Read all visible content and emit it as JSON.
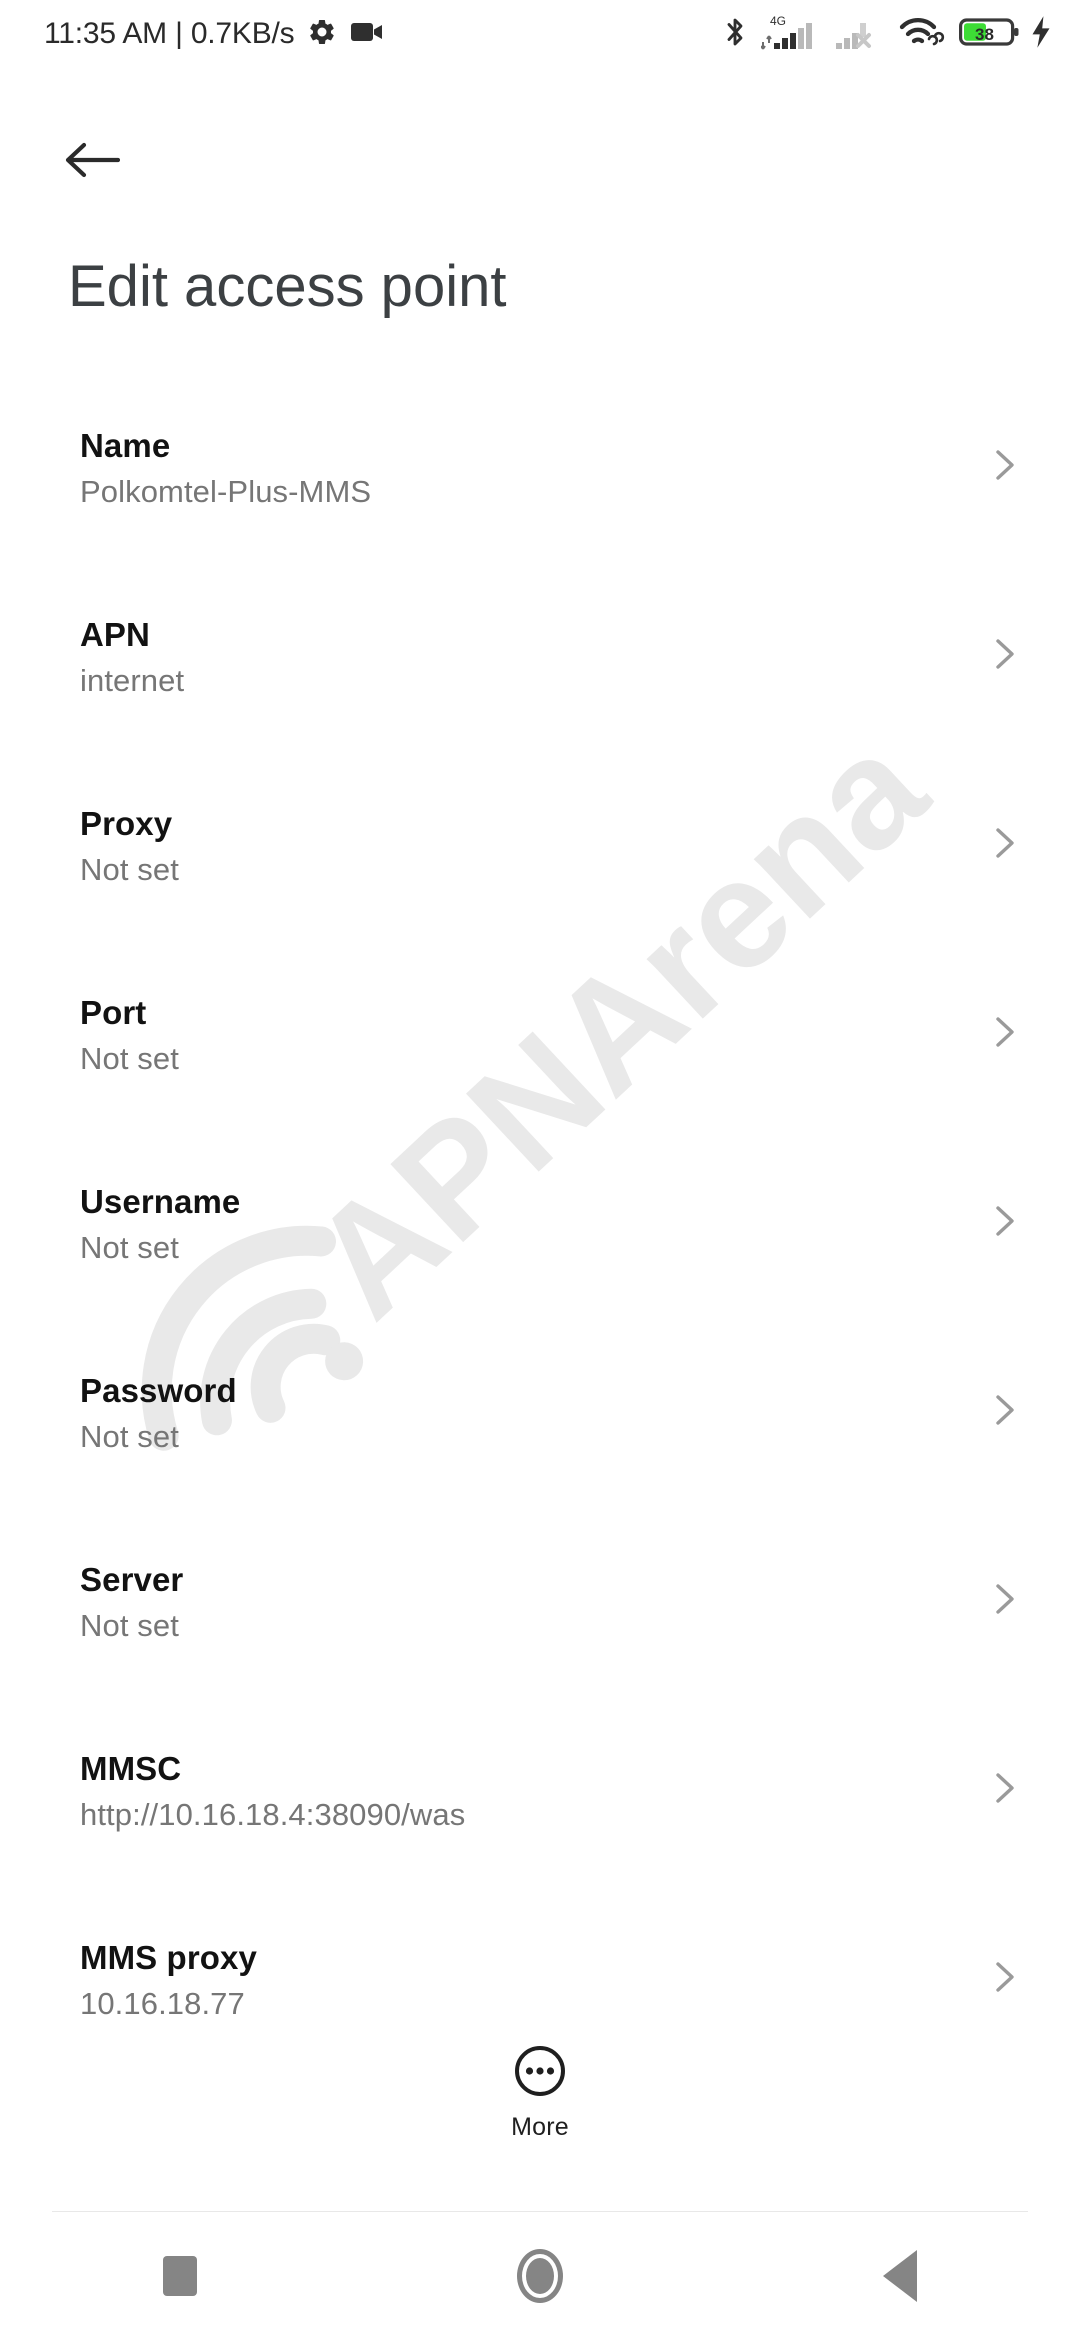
{
  "status_bar": {
    "clock": "11:35 AM",
    "separator": "|",
    "network_speed": "0.7KB/s",
    "left_icons": [
      "gear-icon",
      "video-camera-icon"
    ],
    "right_icons": [
      "bluetooth-icon",
      "signal-4g-icon",
      "signal-sim2-off-icon",
      "wifi-link-icon",
      "battery-icon",
      "charging-bolt-icon"
    ],
    "network_type": "4G",
    "battery_level": "38",
    "battery_color": "#3ddc35",
    "charging": true
  },
  "toolbar": {
    "back_icon": "arrow-back-icon",
    "title": "Edit access point"
  },
  "watermark": {
    "text": "APNArena",
    "color": "#e9e9e9"
  },
  "settings": {
    "rows": [
      {
        "label": "Name",
        "value": "Polkomtel-Plus-MMS"
      },
      {
        "label": "APN",
        "value": "internet"
      },
      {
        "label": "Proxy",
        "value": "Not set"
      },
      {
        "label": "Port",
        "value": "Not set"
      },
      {
        "label": "Username",
        "value": "Not set"
      },
      {
        "label": "Password",
        "value": "Not set"
      },
      {
        "label": "Server",
        "value": "Not set"
      },
      {
        "label": "MMSC",
        "value": "http://10.16.18.4:38090/was"
      },
      {
        "label": "MMS proxy",
        "value": "10.16.18.77"
      }
    ]
  },
  "more_button": {
    "label": "More",
    "icon": "more-circle-icon"
  },
  "nav_bar": {
    "recents_label": "Recents",
    "home_label": "Home",
    "back_label": "Back",
    "icon_color": "#858585"
  }
}
